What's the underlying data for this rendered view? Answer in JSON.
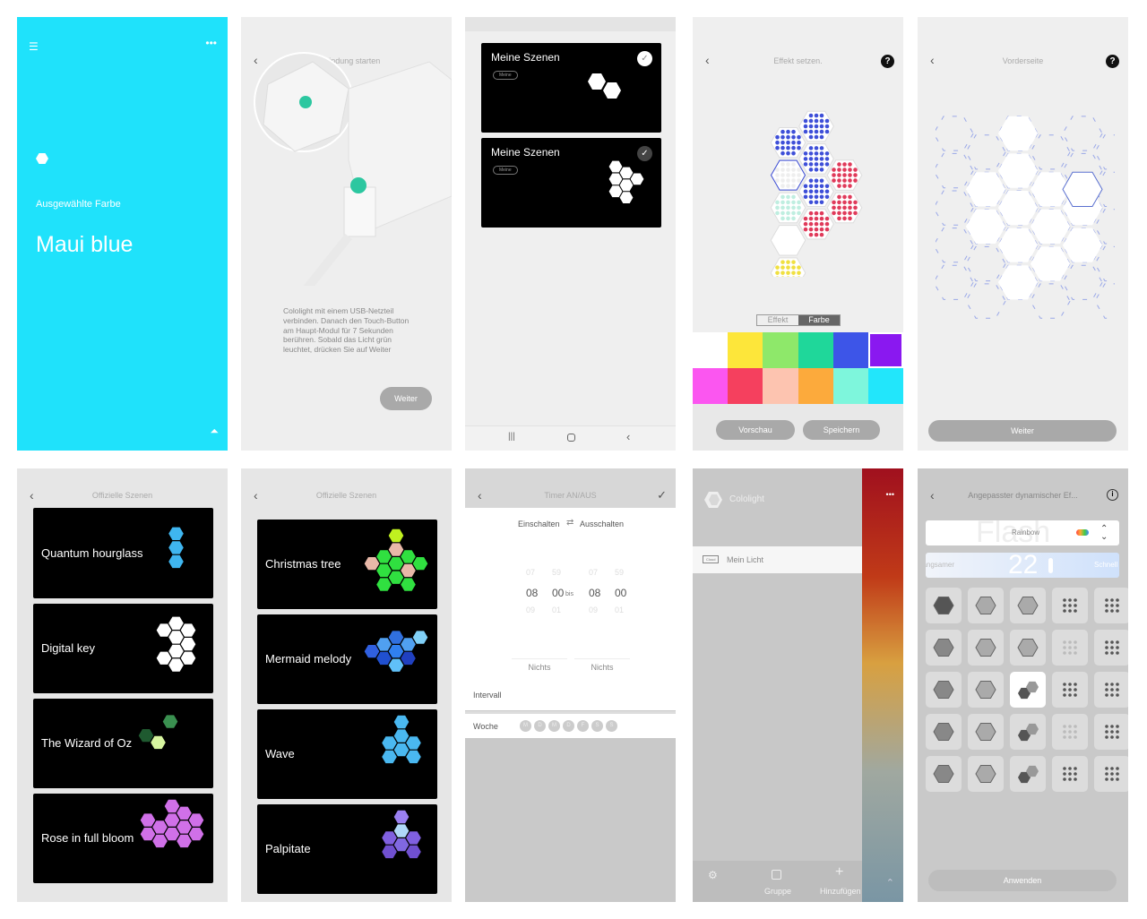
{
  "screen1": {
    "selected_label": "Ausgewählte Farbe",
    "color_name": "Maui blue",
    "bg": "#1fe2fb"
  },
  "screen2": {
    "title": "Verbindung starten",
    "instructions": "Cololight mit einem USB-Netzteil verbinden. Danach den Touch-Button am Haupt-Modul für 7 Sekunden berühren. Sobald das Licht grün leuchtet, drücken Sie auf Weiter",
    "next": "Weiter"
  },
  "screen3": {
    "scenes": [
      {
        "title": "Meine Szenen",
        "tag": "Meine",
        "checked": false
      },
      {
        "title": "Meine Szenen",
        "tag": "Meine",
        "checked": true
      }
    ]
  },
  "screen4": {
    "title": "Effekt setzen.",
    "tabs": [
      "Effekt",
      "Farbe"
    ],
    "active_tab": "Farbe",
    "colors": [
      "#ffffff",
      "#fde63a",
      "#8ee86a",
      "#1fd79a",
      "#3d55e8",
      "#8a18f0",
      "#fb56f0",
      "#f5405e",
      "#fdc4b0",
      "#fcaa3c",
      "#7ef6dc",
      "#22e6fb"
    ],
    "preview": "Vorschau",
    "save": "Speichern"
  },
  "screen5": {
    "title": "Vorderseite",
    "next": "Weiter"
  },
  "screen6": {
    "title": "Offizielle Szenen",
    "scenes": [
      "Quantum hourglass",
      "Digital key",
      "The Wizard of Oz",
      "Rose in full bloom"
    ]
  },
  "screen7": {
    "title": "Offizielle Szenen",
    "scenes": [
      "Christmas tree",
      "Mermaid melody",
      "Wave",
      "Palpitate"
    ]
  },
  "screen8": {
    "title": "Timer AN/AUS",
    "on_label": "Einschalten",
    "off_label": "Ausschalten",
    "on_hours": [
      "07",
      "08",
      "09"
    ],
    "on_minutes": [
      "59",
      "00",
      "01"
    ],
    "off_hours": [
      "07",
      "08",
      "09"
    ],
    "off_minutes": [
      "59",
      "00",
      "01"
    ],
    "bis": "bis",
    "on_action": "Nichts",
    "off_action": "Nichts",
    "interval": "Intervall",
    "week": "Woche",
    "days": [
      "M",
      "D",
      "M",
      "D",
      "F",
      "S",
      "S"
    ]
  },
  "screen9": {
    "brand": "Cololight",
    "device_tag": "Cloud",
    "device_name": "Mein Licht",
    "nav": {
      "group": "Gruppe",
      "add": "Hinzufügen"
    }
  },
  "screen10": {
    "title": "Angepasster dynamischer Ef...",
    "effect_bg": "Flash",
    "effect": "Rainbow",
    "speed": "22",
    "slow": "Langsamer",
    "fast": "Schnell",
    "apply": "Anwenden",
    "selected_tile": 12
  }
}
